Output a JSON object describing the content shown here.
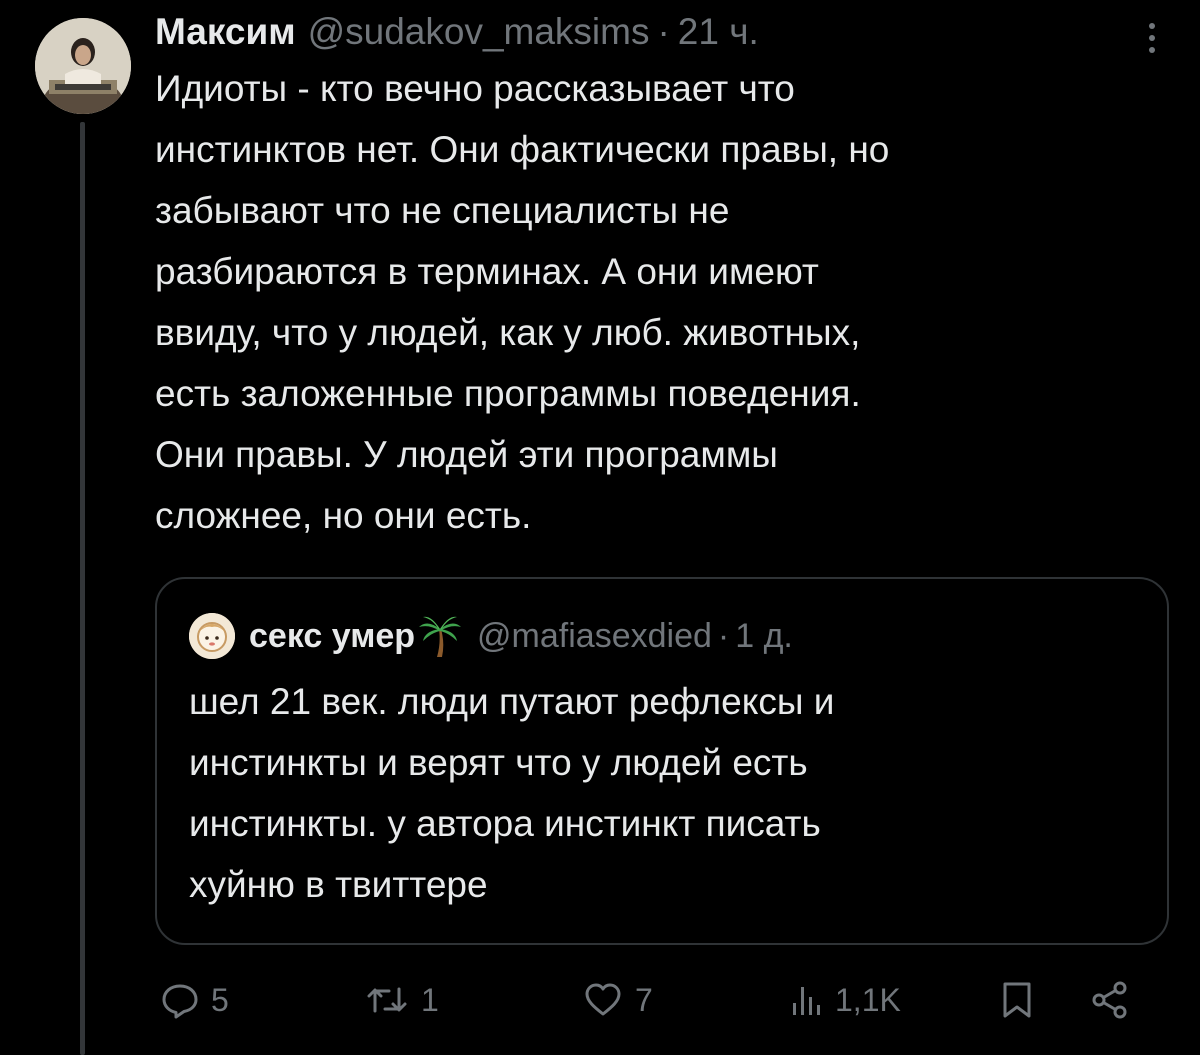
{
  "tweet": {
    "author_name": "Максим",
    "handle": "@sudakov_maksims",
    "separator": "·",
    "time": "21 ч.",
    "text": "Идиоты - кто вечно рассказывает что\nинстинктов нет. Они фактически правы, но\nзабывают что не специалисты не\nразбираются в терминах. А они имеют\nввиду, что у людей, как у люб. животных,\nесть заложенные программы поведения.\nОни правы. У людей эти программы\nсложнее, но они есть."
  },
  "quote": {
    "author_name": "секс умер",
    "emoji_icon": "palm-tree-icon",
    "handle": "@mafiasexdied",
    "separator": "·",
    "time": "1 д.",
    "text": "шел 21 век. люди путают рефлексы и\nинстинкты и верят что у людей есть\nинстинкты. у автора инстинкт писать\nхуйню в твиттере"
  },
  "actions": {
    "replies": "5",
    "retweets": "1",
    "likes": "7",
    "views": "1,1K"
  },
  "colors": {
    "background": "#000000",
    "text": "#e7e9ea",
    "muted": "#71767b",
    "border": "#2f3336"
  }
}
